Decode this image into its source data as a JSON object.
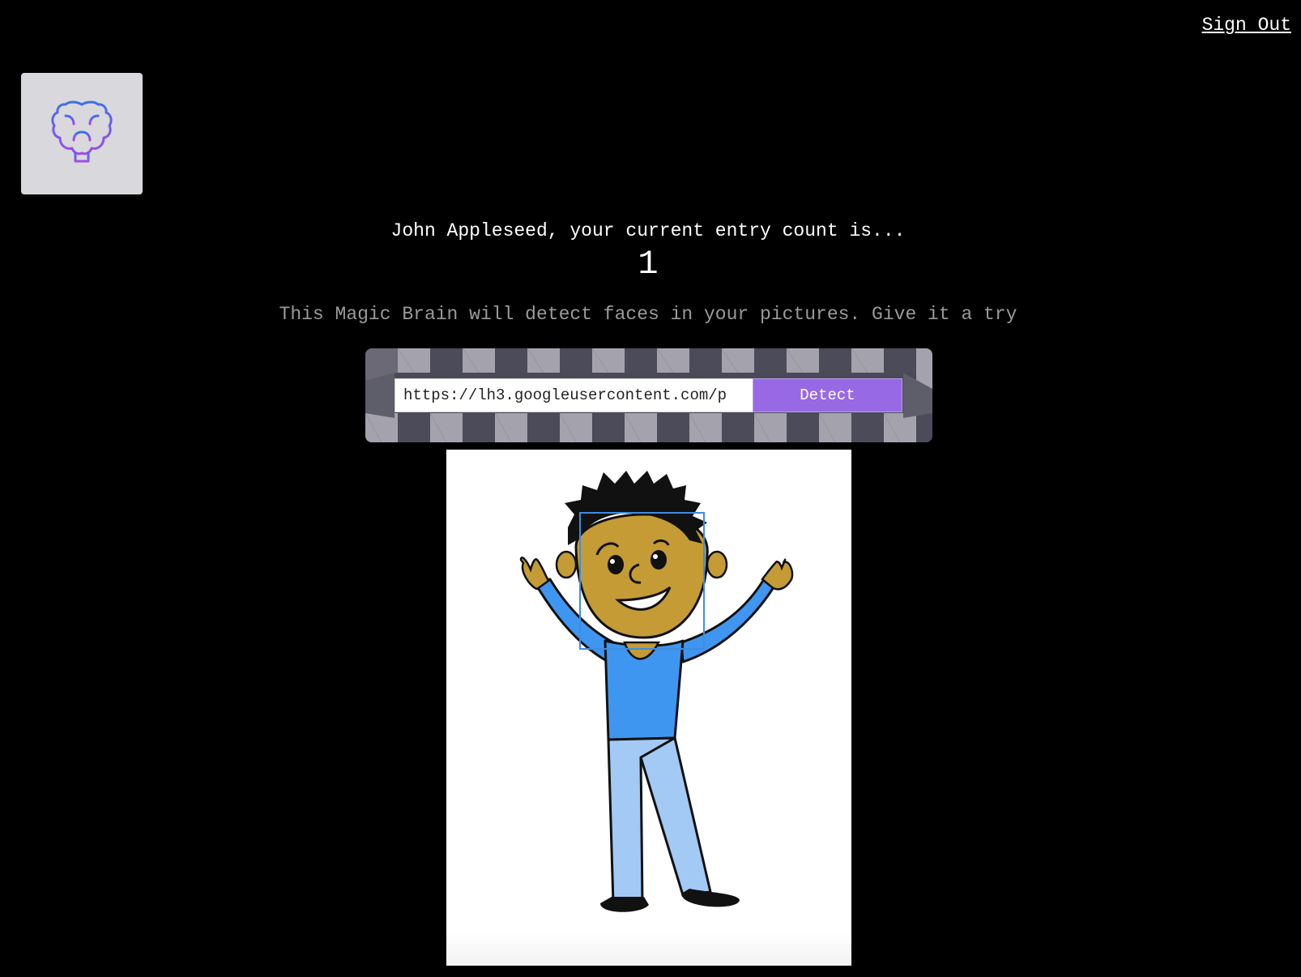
{
  "nav": {
    "sign_out_label": "Sign Out"
  },
  "logo": {
    "icon": "brain-icon",
    "gradient_colors": [
      "#3d6fe8",
      "#a54be8"
    ]
  },
  "rank": {
    "greeting": "John Appleseed, your current entry count is...",
    "entry_count": "1"
  },
  "intro": {
    "text": "This Magic Brain will detect faces in your pictures. Give it a try"
  },
  "form": {
    "url_value": "https://lh3.googleusercontent.com/p",
    "detect_label": "Detect",
    "button_color": "#9869e5"
  },
  "result": {
    "face_box_color": "#3f8de0",
    "faces_detected": 1
  }
}
